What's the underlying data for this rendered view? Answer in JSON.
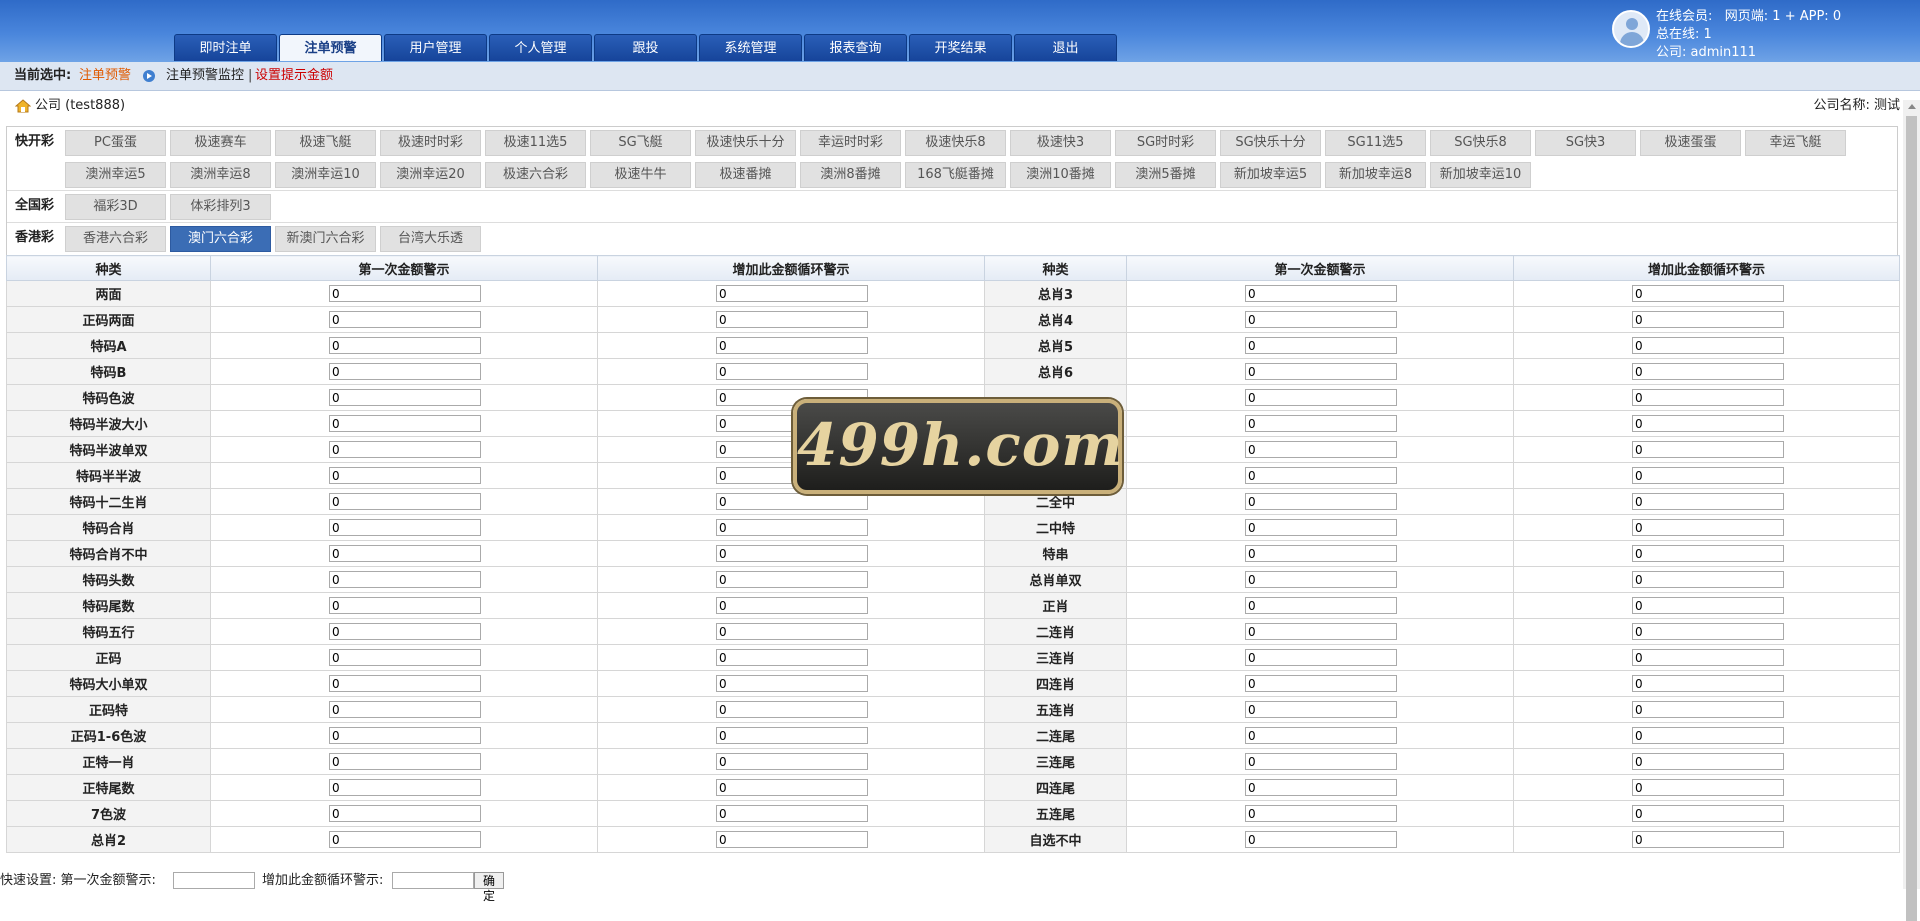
{
  "nav": [
    "即时注单",
    "注单预警",
    "用户管理",
    "个人管理",
    "跟投",
    "系统管理",
    "报表查询",
    "开奖结果",
    "退出"
  ],
  "nav_active": 1,
  "user": {
    "online_label": "在线会员:",
    "online_web": "网页端: 1 + APP: 0",
    "total_online": "总在线: 1",
    "company": "公司: admin111"
  },
  "subbar": {
    "label": "当前选中:",
    "current": "注单预警",
    "monitor": "注单预警监控",
    "sep": "|",
    "set_amount": "设置提示金额"
  },
  "crumb": {
    "company": "公司 (test888)",
    "company_name": "公司名称: 测试"
  },
  "lottery": {
    "fast_label": "快开彩",
    "fast_row1": [
      "PC蛋蛋",
      "极速赛车",
      "极速飞艇",
      "极速时时彩",
      "极速11选5",
      "SG飞艇",
      "极速快乐十分",
      "幸运时时彩",
      "极速快乐8",
      "极速快3",
      "SG时时彩",
      "SG快乐十分",
      "SG11选5",
      "SG快乐8",
      "SG快3",
      "极速蛋蛋",
      "幸运飞艇"
    ],
    "fast_row2": [
      "澳洲幸运5",
      "澳洲幸运8",
      "澳洲幸运10",
      "澳洲幸运20",
      "极速六合彩",
      "极速牛牛",
      "极速番摊",
      "澳洲8番摊",
      "168飞艇番摊",
      "澳洲10番摊",
      "澳洲5番摊",
      "新加坡幸运5",
      "新加坡幸运8",
      "新加坡幸运10"
    ],
    "national_label": "全国彩",
    "national": [
      "福彩3D",
      "体彩排列3"
    ],
    "hk_label": "香港彩",
    "hk": [
      "香港六合彩",
      "澳门六合彩",
      "新澳门六合彩",
      "台湾大乐透"
    ],
    "hk_selected": 1
  },
  "table": {
    "headers": [
      "种类",
      "第一次金额警示",
      "增加此金额循环警示",
      "种类",
      "第一次金额警示",
      "增加此金额循环警示"
    ],
    "rows": [
      {
        "l": "两面",
        "r": "总肖3"
      },
      {
        "l": "正码两面",
        "r": "总肖4"
      },
      {
        "l": "特码A",
        "r": "总肖5"
      },
      {
        "l": "特码B",
        "r": "总肖6"
      },
      {
        "l": "特码色波",
        "r": ""
      },
      {
        "l": "特码半波大小",
        "r": ""
      },
      {
        "l": "特码半波单双",
        "r": ""
      },
      {
        "l": "特码半半波",
        "r": ""
      },
      {
        "l": "特码十二生肖",
        "r": "二全中"
      },
      {
        "l": "特码合肖",
        "r": "二中特"
      },
      {
        "l": "特码合肖不中",
        "r": "特串"
      },
      {
        "l": "特码头数",
        "r": "总肖单双"
      },
      {
        "l": "特码尾数",
        "r": "正肖"
      },
      {
        "l": "特码五行",
        "r": "二连肖"
      },
      {
        "l": "正码",
        "r": "三连肖"
      },
      {
        "l": "特码大小单双",
        "r": "四连肖"
      },
      {
        "l": "正码特",
        "r": "五连肖"
      },
      {
        "l": "正码1-6色波",
        "r": "二连尾"
      },
      {
        "l": "正特一肖",
        "r": "三连尾"
      },
      {
        "l": "正特尾数",
        "r": "四连尾"
      },
      {
        "l": "7色波",
        "r": "五连尾"
      },
      {
        "l": "总肖2",
        "r": "自选不中"
      }
    ],
    "default_value": "0"
  },
  "footer": {
    "quick": "快速设置:  第一次金额警示:",
    "second": "增加此金额循环警示:",
    "ok": "确定"
  },
  "watermark": "499h.com"
}
